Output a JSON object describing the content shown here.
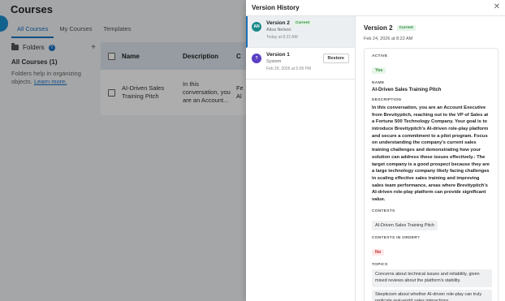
{
  "background": {
    "title": "Courses",
    "tabs": [
      "All Courses",
      "My Courses",
      "Templates"
    ],
    "folders_label": "Folders",
    "all_courses_label": "All Courses",
    "all_courses_count": "(1)",
    "help_text": "Folders help in organizing objects.",
    "help_link": "Learn more.",
    "table": {
      "headers": [
        "Name",
        "Description",
        "C"
      ],
      "rows": [
        {
          "name": "AI-Driven Sales Training Pitch",
          "description": "In this conversation, you are an Account...",
          "extra": "Fe Al"
        }
      ]
    }
  },
  "drawer": {
    "title": "Version History",
    "close_icon": "close-icon",
    "versions": [
      {
        "name": "Version 2",
        "badge": "Current",
        "author": "Alisa Nelson",
        "date": "Today at 8:22 AM",
        "initials": "AN",
        "avatar_color": "#1a8a8a"
      },
      {
        "name": "Version 1",
        "author": "System",
        "date": "Feb 20, 2026 at 5:09 PM",
        "initials": "?",
        "avatar_color": "#5b3fc4",
        "action": "Restore"
      }
    ],
    "detail": {
      "version": "Version 2",
      "badge": "Current",
      "date": "Feb 24, 2026 at 8:22 AM",
      "active_label": "ACTIVE",
      "active_value": "Yes",
      "name_label": "NAME",
      "name_value": "AI-Driven Sales Training Pitch",
      "description_label": "DESCRIPTION",
      "description_value": "In this conversation, you are an Account Executive from Brevitypitch, reaching out to the VP of Sales at a Fortune 500 Technology Company. Your goal is to introduce Brevitypitch's AI-driven role-play platform and secure a commitment to a pilot program. Focus on understanding the company's current sales training challenges and demonstrating how your solution can address these issues effectively.: The target company is a good prospect because they are a large technology company likely facing challenges in scaling effective sales training and improving sales team performance, areas where Brevitypitch's AI-driven role-play platform can provide significant value.",
      "contexts_label": "CONTEXTS",
      "contexts_value": "AI-Driven Sales Training Pitch",
      "contexts_order_label": "CONTEXTS IN ORDER?",
      "contexts_order_value": "No",
      "topics_label": "TOPICS",
      "topics": [
        "Concerns about technical issues and reliability, given mixed reviews about the platform's stability.",
        "Skepticism about whether AI-driven role-play can truly replicate real-world sales interactions."
      ]
    }
  }
}
